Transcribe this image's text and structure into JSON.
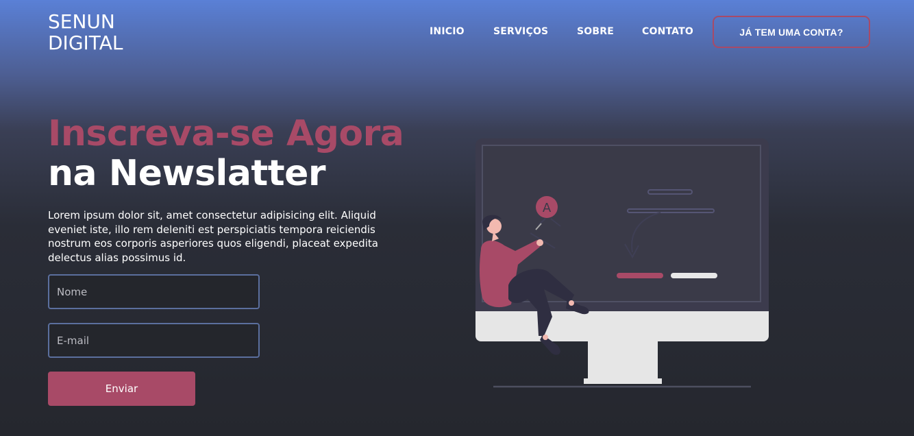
{
  "brand": {
    "line1": "SENUN",
    "line2": "DIGITAL"
  },
  "nav": {
    "items": [
      "INICIO",
      "SERVIÇOS",
      "SOBRE",
      "CONTATO"
    ],
    "login": "JÁ TEM UMA CONTA?"
  },
  "hero": {
    "title_highlight": "Inscreva-se Agora",
    "title_main": "na Newslatter",
    "description": "Lorem ipsum dolor sit, amet consectetur adipisicing elit. Aliquid eveniet iste, illo rem deleniti est perspiciatis tempora reiciendis nostrum eos corporis asperiores quos eligendi, placeat expedita delectus alias possimus id."
  },
  "form": {
    "name_placeholder": "Nome",
    "email_placeholder": "E-mail",
    "submit_label": "Enviar"
  },
  "illustration": {
    "letter": "A",
    "icon": "person-at-monitor-illustration"
  },
  "colors": {
    "accent": "#a84a67",
    "input_border": "#5b6f9e",
    "background_top": "#5a80d6",
    "background_bottom": "#25272e"
  }
}
